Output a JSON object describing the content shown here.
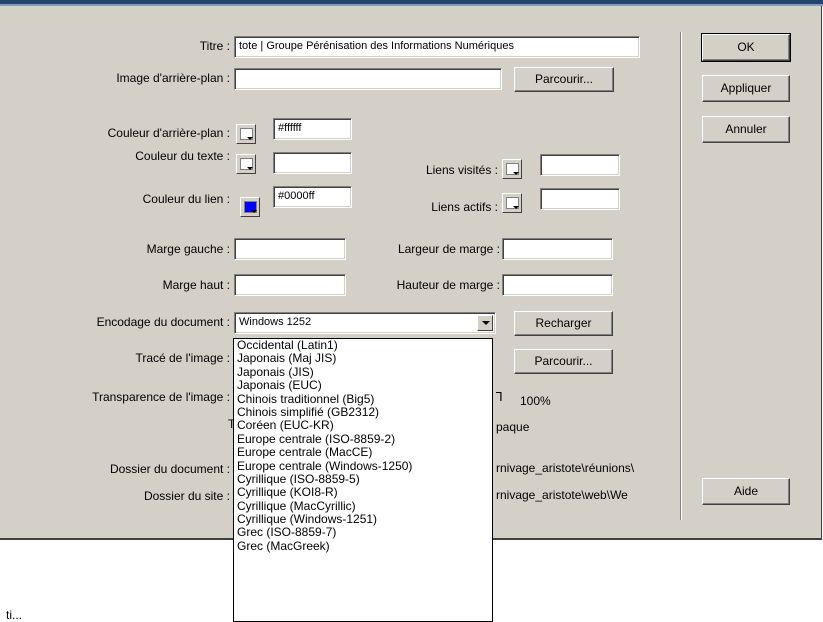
{
  "dialog": {
    "buttons": {
      "ok": "OK",
      "apply": "Appliquer",
      "cancel": "Annuler",
      "help": "Aide"
    },
    "labels": {
      "title": "Titre :",
      "background_image": "Image d'arrière-plan :",
      "background_color": "Couleur d'arrière-plan :",
      "text_color": "Couleur du texte :",
      "visited_links": "Liens visités :",
      "link_color": "Couleur du lien :",
      "active_links": "Liens actifs :",
      "left_margin": "Marge gauche :",
      "margin_width": "Largeur de marge :",
      "top_margin": "Marge haut :",
      "margin_height": "Hauteur de marge :",
      "encoding": "Encodage du document :",
      "tracing_image": "Tracé de l'image :",
      "image_transparency": "Transparence de l'image :",
      "transparent_partial": "T",
      "opaque_partial": "paque",
      "document_folder": "Dossier du document :",
      "site_folder": "Dossier du site :"
    },
    "values": {
      "title": "tote | Groupe Pérénisation des Informations Numériques",
      "background_image": "",
      "background_color": "#ffffff",
      "text_color": "",
      "visited_links": "",
      "link_color": "#0000ff",
      "active_links": "",
      "left_margin": "",
      "margin_width": "",
      "top_margin": "",
      "margin_height": "",
      "encoding": "Windows 1252",
      "transparency_percent": "100%",
      "document_folder": "rnivage_aristote\\réunions\\",
      "site_folder": "rnivage_aristote\\web\\We"
    },
    "browse_label": "Parcourir...",
    "browse_label2": "Parcourir...",
    "reload_label": "Recharger",
    "encoding_options": [
      "Occidental (Latin1)",
      "Japonais (Maj JIS)",
      "Japonais (JIS)",
      "Japonais (EUC)",
      "Chinois traditionnel (Big5)",
      "Chinois simplifié (GB2312)",
      "Coréen (EUC-KR)",
      "Europe centrale (ISO-8859-2)",
      "Europe centrale (MacCE)",
      "Europe centrale (Windows-1250)",
      "Cyrillique (ISO-8859-5)",
      "Cyrillique (KOI8-R)",
      "Cyrillique (MacCyrillic)",
      "Cyrillique (Windows-1251)",
      "Grec (ISO-8859-7)",
      "Grec (MacGreek)"
    ],
    "colors": {
      "link_swatch": "#0000ff"
    }
  },
  "below": {
    "text": "ti..."
  }
}
